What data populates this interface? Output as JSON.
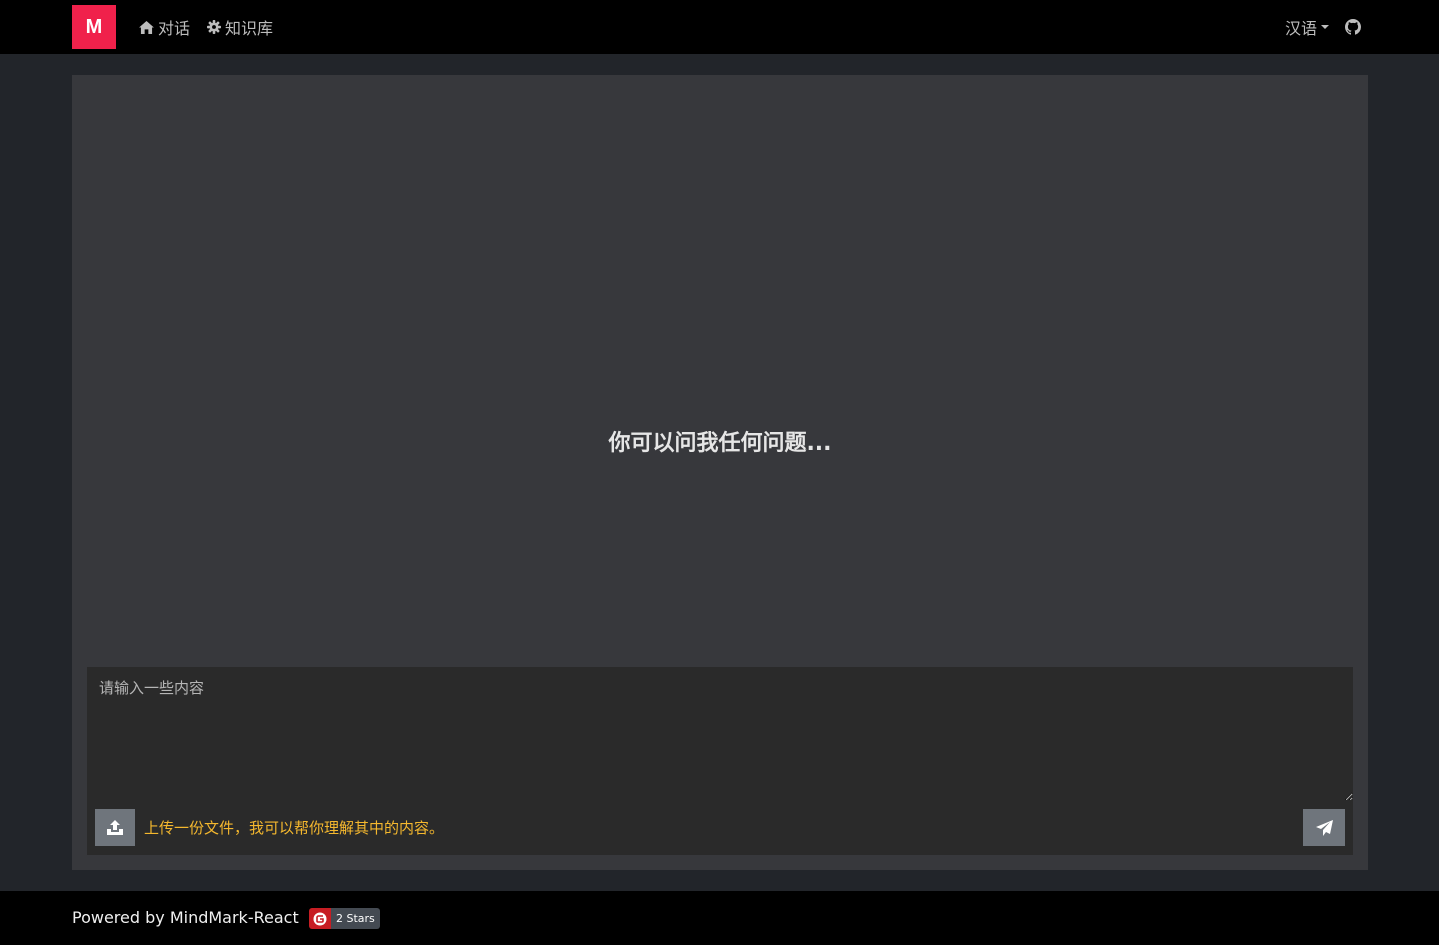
{
  "navbar": {
    "brand": "M",
    "links": [
      {
        "label": "对话",
        "icon": "home-icon"
      },
      {
        "label": "知识库",
        "icon": "gear-icon"
      }
    ],
    "language": "汉语",
    "github_icon": "github-icon"
  },
  "main": {
    "prompt_title": "你可以问我任何问题...",
    "input_placeholder": "请输入一些内容",
    "upload_hint": "上传一份文件，我可以帮你理解其中的内容。",
    "upload_icon": "upload-icon",
    "send_icon": "send-icon"
  },
  "footer": {
    "powered_by": "Powered by MindMark-React",
    "stars": "2 Stars"
  },
  "colors": {
    "brand": "#f0214b",
    "hint": "#f5b82e",
    "navbar": "#000000",
    "panel": "#37383c"
  }
}
